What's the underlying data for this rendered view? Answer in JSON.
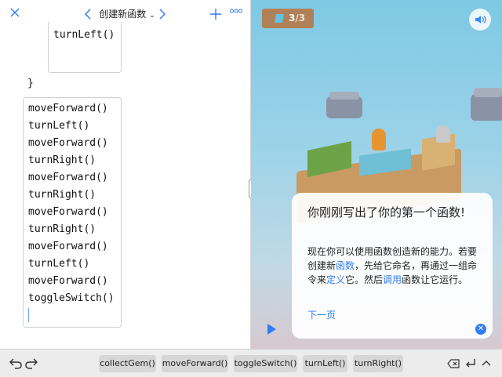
{
  "toolbar": {
    "title": "创建新函数"
  },
  "editor": {
    "first_block_line": "turnLeft()",
    "closing_brace": "}",
    "lines": [
      "moveForward()",
      "turnLeft()",
      "moveForward()",
      "turnRight()",
      "moveForward()",
      "turnRight()",
      "moveForward()",
      "turnRight()",
      "moveForward()",
      "turnLeft()",
      "moveForward()",
      "toggleSwitch()"
    ]
  },
  "scene": {
    "gem_count": "3",
    "gem_total": "/3"
  },
  "sheet": {
    "title": "你刚刚写出了你的第一个函数!",
    "p1": "现在你可以使用函数创造新的能力。若要创建新",
    "kw1": "函数",
    "p2": "，先给它命名，再通过一组命令来",
    "kw2": "定义",
    "p3": "它。然后",
    "kw3": "调用",
    "p4": "函数让它运行。",
    "next_label": "下一页"
  },
  "shortcuts": [
    "collectGem()",
    "moveForward()",
    "toggleSwitch()",
    "turnLeft()",
    "turnRight()"
  ],
  "colors": {
    "accent": "#2f7cf6"
  }
}
